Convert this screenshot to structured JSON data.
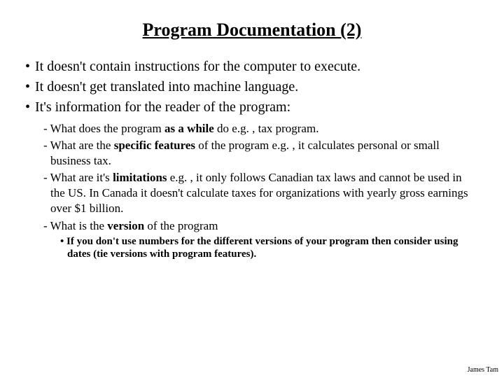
{
  "title": "Program Documentation (2)",
  "bullets": [
    "It doesn't contain instructions for the computer to execute.",
    "It doesn't get translated into machine language.",
    "It's information for the reader of the program:"
  ],
  "sub": {
    "item0_pre": "What does the program ",
    "item0_b": "as a while",
    "item0_post": " do e.g. , tax program.",
    "item1_pre": "What are the ",
    "item1_b": "specific features",
    "item1_post": " of the program e.g. , it calculates personal or small business tax.",
    "item2_pre": "What are it's ",
    "item2_b": "limitations",
    "item2_post": " e.g. , it only follows Canadian tax laws and cannot be used in the US. In Canada it doesn't calculate taxes for organizations with yearly gross earnings over $1 billion.",
    "item3_pre": "What is the ",
    "item3_b": "version",
    "item3_post": " of the program"
  },
  "subsub": "If you don't use numbers for the different versions of your program then consider using dates (tie versions with program features).",
  "footer": "James Tam"
}
